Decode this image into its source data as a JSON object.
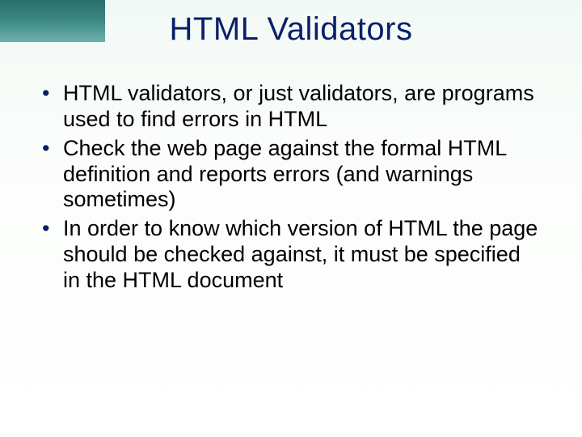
{
  "slide": {
    "title": "HTML Validators",
    "bullets": [
      "HTML validators, or just validators, are programs used to find errors in HTML",
      "Check the web page against the formal HTML definition and reports errors (and warnings sometimes)",
      "In order to know which version of HTML the page should be checked against, it must be specified in the HTML document"
    ]
  }
}
